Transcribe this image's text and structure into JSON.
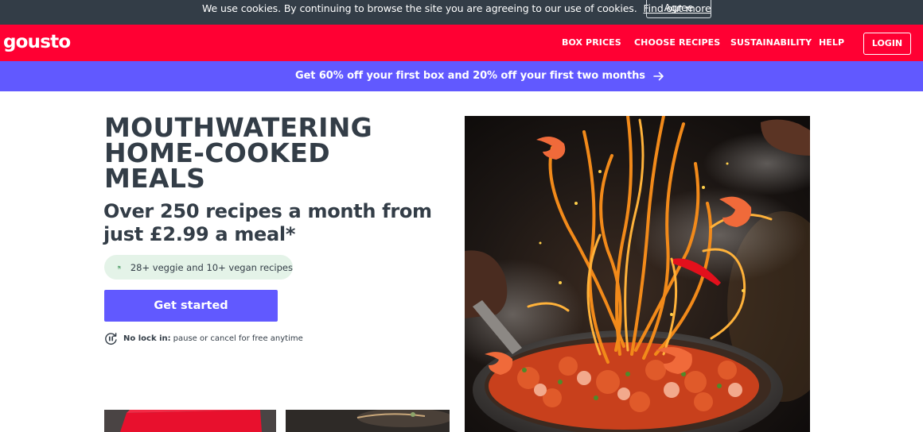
{
  "cookie_bar": {
    "message": "We use cookies. By continuing to browse the site you are agreeing to our use of cookies.",
    "link_label": "Find out more",
    "agree_label": "Agree"
  },
  "header": {
    "logo": "gousto",
    "nav": {
      "box_prices": "BOX PRICES",
      "choose_recipes": "CHOOSE RECIPES",
      "sustainability": "SUSTAINABILITY",
      "help": "HELP"
    },
    "login_label": "LOGIN"
  },
  "promo": {
    "text": "Get 60% off your first box and 20% off your first two months",
    "icon": "arrow-right-icon"
  },
  "hero": {
    "title": "MOUTHWATERING HOME-COOKED MEALS",
    "subtitle": "Over 250 recipes a month from just £2.99 a meal*",
    "veg_text": "28+ veggie and 10+ vegan recipes",
    "veg_icon": "cutlery-icon",
    "cta_label": "Get started",
    "nolock_bold": "No lock in:",
    "nolock_text": "pause or cancel for free anytime",
    "nolock_icon": "pause-cycle-icon"
  },
  "colors": {
    "cookie_bg": "#333d47",
    "brand_red": "#ff0033",
    "brand_purple": "#6159ff",
    "pill_green": "#e4f3e8",
    "icon_green": "#1b7f3b",
    "text_dark": "#333d47"
  }
}
